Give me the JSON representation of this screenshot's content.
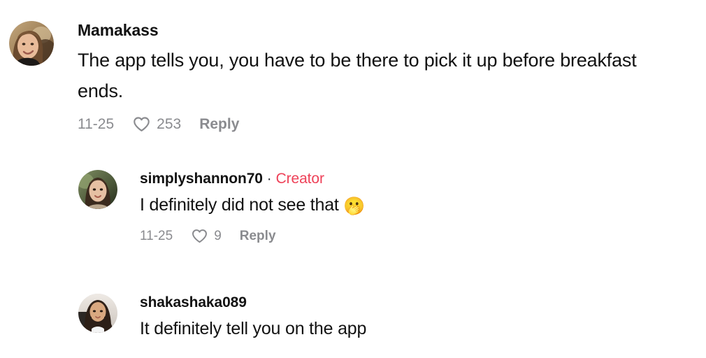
{
  "app": "tiktok-comments",
  "theme": {
    "background": "#ffffff",
    "text_primary": "#121212",
    "text_muted": "#8a8b8f",
    "creator_accent": "#ee4158"
  },
  "comments": [
    {
      "id": "root",
      "username": "Mamakass",
      "is_creator": false,
      "creator_label": "",
      "separator": "",
      "text": "The app tells you, you have to be there to pick it up before breakfast ends.",
      "emoji": "",
      "date": "11-25",
      "like_count": "253",
      "reply_label": "Reply",
      "heart_icon": "heart-outline-icon",
      "avatar": {
        "alt": "Mamakass profile photo",
        "description": "smiling woman with light brown hair, warm tan outdoor background",
        "hair": "#6b4a2e",
        "skin": "#e8bb99",
        "bg_top": "#b79a72",
        "bg_bottom": "#8a6b46"
      }
    },
    {
      "id": "reply-1",
      "username": "simplyshannon70",
      "is_creator": true,
      "creator_label": "Creator",
      "separator": "·",
      "text": "I definitely did not see that ",
      "emoji": "🫢",
      "date": "11-25",
      "like_count": "9",
      "reply_label": "Reply",
      "heart_icon": "heart-outline-icon",
      "avatar": {
        "alt": "simplyshannon70 profile photo",
        "description": "woman with long dark brown hair against green foliage background",
        "hair": "#3b2a1d",
        "skin": "#e6c0a3",
        "bg_top": "#6d7a55",
        "bg_bottom": "#2f3a26"
      }
    },
    {
      "id": "reply-2",
      "username": "shakashaka089",
      "is_creator": false,
      "creator_label": "",
      "separator": "",
      "text": "It definitely tell you on the app",
      "emoji": "",
      "date": "",
      "like_count": "",
      "reply_label": "",
      "heart_icon": "",
      "avatar": {
        "alt": "shakashaka089 profile photo",
        "description": "woman with long dark hair wearing a white top, light background",
        "hair": "#2d1f17",
        "skin": "#d9a880",
        "bg_top": "#ece7e2",
        "bg_bottom": "#cfc8c2"
      }
    }
  ]
}
